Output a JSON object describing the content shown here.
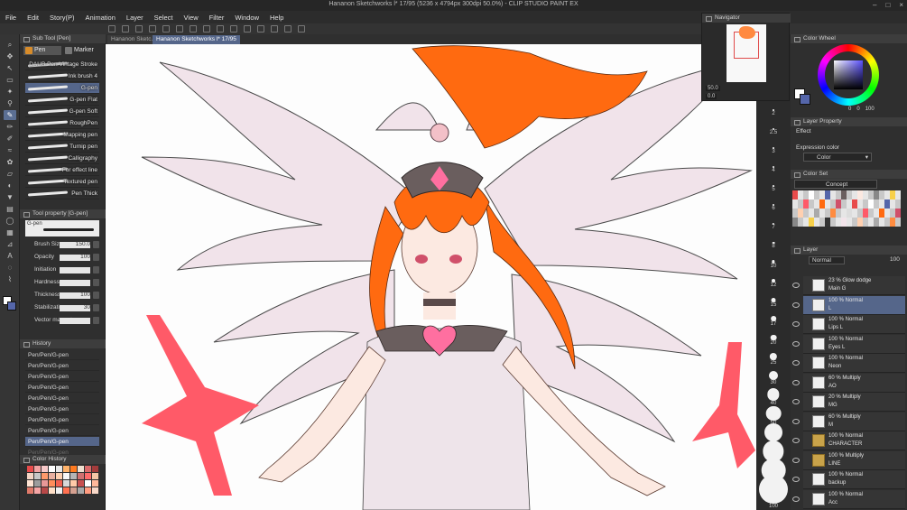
{
  "window": {
    "title": "Hananon Sketchworks l* 17/95 (5236 x 4794px 300dpi 50.0%) - CLIP STUDIO PAINT EX"
  },
  "menu": [
    "File",
    "Edit",
    "Story(P)",
    "Animation",
    "Layer",
    "Select",
    "View",
    "Filter",
    "Window",
    "Help"
  ],
  "sub_tool": {
    "header": "Sub Tool [Pen]",
    "tabs": [
      {
        "label": "Pen",
        "active": true
      },
      {
        "label": "Marker",
        "active": false
      }
    ],
    "brushes": [
      {
        "name": "DAUB Pen Vintage Stroke",
        "selected": false
      },
      {
        "name": "Ink brush 4",
        "selected": false
      },
      {
        "name": "G-pen",
        "selected": true
      },
      {
        "name": "G-pen Flat",
        "selected": false
      },
      {
        "name": "G-pen Soft",
        "selected": false
      },
      {
        "name": "RoughPen",
        "selected": false
      },
      {
        "name": "Mapping pen",
        "selected": false
      },
      {
        "name": "Turnip pen",
        "selected": false
      },
      {
        "name": "Calligraphy",
        "selected": false
      },
      {
        "name": "For effect line",
        "selected": false
      },
      {
        "name": "Textured pen",
        "selected": false
      },
      {
        "name": "Pen Thick",
        "selected": false
      }
    ]
  },
  "tool_property": {
    "header": "Tool property [G-pen]",
    "tool_name": "G-pen",
    "rows": [
      {
        "label": "Brush Size",
        "value": "150.0"
      },
      {
        "label": "Opacity",
        "value": "100"
      },
      {
        "label": "Initiation",
        "value": ""
      },
      {
        "label": "Hardness",
        "value": ""
      },
      {
        "label": "Thickness",
        "value": "100"
      },
      {
        "label": "Stabilization",
        "value": "30"
      },
      {
        "label": "Vector magnet",
        "value": ""
      }
    ]
  },
  "history": {
    "header": "History",
    "items": [
      {
        "label": "Pen/Pen/G-pen",
        "state": "normal"
      },
      {
        "label": "Pen/Pen/G-pen",
        "state": "normal"
      },
      {
        "label": "Pen/Pen/G-pen",
        "state": "normal"
      },
      {
        "label": "Pen/Pen/G-pen",
        "state": "normal"
      },
      {
        "label": "Pen/Pen/G-pen",
        "state": "normal"
      },
      {
        "label": "Pen/Pen/G-pen",
        "state": "normal"
      },
      {
        "label": "Pen/Pen/G-pen",
        "state": "normal"
      },
      {
        "label": "Pen/Pen/G-pen",
        "state": "normal"
      },
      {
        "label": "Pen/Pen/G-pen",
        "state": "selected"
      },
      {
        "label": "Pen/Pen/G-pen",
        "state": "undone"
      }
    ]
  },
  "color_history": {
    "header": "Color History",
    "swatches": [
      "#e84b4b",
      "#f2a3a3",
      "#f7c9c9",
      "#ffffff",
      "#e8e8e8",
      "#ffb36b",
      "#ff7a1f",
      "#f0e0d0",
      "#d96a6a",
      "#a33b3b",
      "#f4d4c4",
      "#c7c7c7",
      "#ff9a6b",
      "#e8b0a0",
      "#ffd0b0",
      "#f8f8f8",
      "#b5b5b5",
      "#d07070",
      "#ff6b6b",
      "#f3c6a6",
      "#ffe4d4",
      "#9c9c9c",
      "#e89898",
      "#ff8c5a",
      "#f06050",
      "#d8d8d8",
      "#ffcaa8",
      "#c85050",
      "#ffffff",
      "#ffb89a",
      "#e07a6a",
      "#f5a5a5",
      "#b84848",
      "#ffe0c8",
      "#f0f0f0",
      "#ff7050",
      "#d4a090",
      "#a8a8a8",
      "#ff9c80",
      "#f8d8c8"
    ]
  },
  "document_tabs": [
    {
      "label": "Hananon Sketc...",
      "active": false
    },
    {
      "label": "Hananon Sketchworks l* 17/95",
      "active": true
    }
  ],
  "brush_size_palette": [
    {
      "label": "2"
    },
    {
      "label": "2.5"
    },
    {
      "label": "3"
    },
    {
      "label": "4"
    },
    {
      "label": "5"
    },
    {
      "label": "6"
    },
    {
      "label": "7"
    },
    {
      "label": "8"
    },
    {
      "label": "10"
    },
    {
      "label": "12"
    },
    {
      "label": "15"
    },
    {
      "label": "17"
    },
    {
      "label": "20"
    },
    {
      "label": "25"
    },
    {
      "label": "30"
    },
    {
      "label": "40"
    },
    {
      "label": "50"
    },
    {
      "label": "60"
    },
    {
      "label": "70"
    },
    {
      "label": "80"
    },
    {
      "label": "100"
    }
  ],
  "navigator": {
    "header": "Navigator",
    "zoom": "50.0",
    "rotation": "0.0"
  },
  "color_wheel": {
    "header": "Color Wheel",
    "h_value": "0",
    "s_value": "0",
    "v_value": "100",
    "main_color": "#ffffff",
    "sub_color": "#5566aa"
  },
  "layer_property": {
    "header": "Layer Property",
    "effect_label": "Effect",
    "expression_color_label": "Expression color",
    "expression_color_value": "Color"
  },
  "color_set": {
    "header": "Color Set",
    "set_name": "Concept"
  },
  "layer_panel": {
    "header": "Layer",
    "blend_mode": "Normal",
    "opacity": "100",
    "layers": [
      {
        "mode": "23 % Glow dodge",
        "name": "Main G",
        "selected": false,
        "folder": false
      },
      {
        "mode": "100 % Normal",
        "name": "L",
        "selected": true,
        "folder": false
      },
      {
        "mode": "100 % Normal",
        "name": "Lips L",
        "selected": false,
        "folder": false
      },
      {
        "mode": "100 % Normal",
        "name": "Eyes L",
        "selected": false,
        "folder": false
      },
      {
        "mode": "100 % Normal",
        "name": "Neon",
        "selected": false,
        "folder": false
      },
      {
        "mode": "60 % Multiply",
        "name": "AO",
        "selected": false,
        "folder": false
      },
      {
        "mode": "20 % Multiply",
        "name": "MG",
        "selected": false,
        "folder": false
      },
      {
        "mode": "60 % Multiply",
        "name": "M",
        "selected": false,
        "folder": false
      },
      {
        "mode": "100 % Normal",
        "name": "CHARACTER",
        "selected": false,
        "folder": true
      },
      {
        "mode": "100 % Multiply",
        "name": "LINE",
        "selected": false,
        "folder": true
      },
      {
        "mode": "100 % Normal",
        "name": "backup",
        "selected": false,
        "folder": false
      },
      {
        "mode": "100 % Normal",
        "name": "Acc",
        "selected": false,
        "folder": false
      }
    ]
  },
  "colors": {
    "accent": "#55668a",
    "hair": "#ff6a10",
    "neon": "#ff5a6a",
    "wing": "#f2e4ea"
  }
}
